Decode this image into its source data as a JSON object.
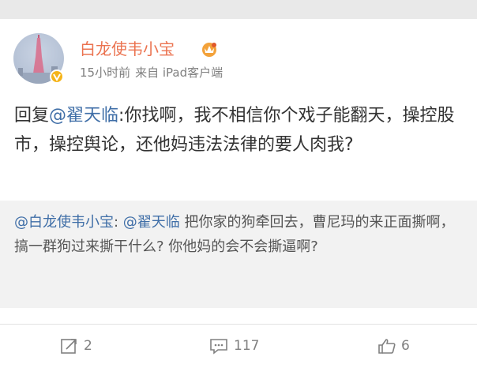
{
  "post": {
    "author": "白龙使韦小宝",
    "time": "15小时前",
    "source": "来自 iPad客户端",
    "text_prefix": "回复",
    "mention": "@翟天临",
    "text_body": ":你找啊，我不相信你个戏子能翻天，操控股市，操控舆论，还他妈违法法律的要人肉我?"
  },
  "quote": {
    "author_mention": "@白龙使韦小宝",
    "colon": ": ",
    "mention": "@翟天临",
    "text": " 把你家的狗牵回去，曹尼玛的来正面撕啊，搞一群狗过来撕干什么? 你他妈的会不会撕逼啊?"
  },
  "actions": {
    "repost_count": "2",
    "comment_count": "117",
    "like_count": "6"
  },
  "icons": {
    "avatar": "tower-avatar-icon",
    "verified": "verified-badge-icon",
    "vip": "vip-crown-icon",
    "repost": "repost-icon",
    "comment": "comment-icon",
    "like": "thumbs-up-icon"
  },
  "colors": {
    "username": "#eb7350",
    "mention": "#3f6ea7",
    "verified_badge": "#f5b41a"
  }
}
